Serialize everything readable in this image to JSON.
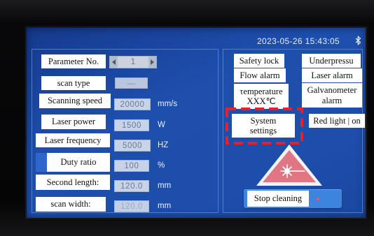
{
  "status_bar": {
    "datetime": "2023-05-26 15:43:05",
    "bluetooth_icon": "bluetooth-icon"
  },
  "parameters": {
    "parameter_no": {
      "label": "Parameter No.",
      "value": "1",
      "decrement_icon": "arrow-left-icon",
      "increment_icon": "arrow-right-icon"
    },
    "scan_type": {
      "label": "scan type",
      "value": "—"
    },
    "scanning_speed": {
      "label": "Scanning speed",
      "value": "20000",
      "unit": "mm/s"
    },
    "laser_power": {
      "label": "Laser power",
      "value": "1500",
      "unit": "W"
    },
    "laser_frequency": {
      "label": "Laser frequency",
      "value": "5000",
      "unit": "HZ"
    },
    "duty_ratio": {
      "label": "Duty ratio",
      "value": "100",
      "unit": "%"
    },
    "second_length": {
      "label": "Second length:",
      "value": "120.0",
      "unit": "mm"
    },
    "scan_width": {
      "label": "scan width:",
      "value": "120.0",
      "unit": "mm"
    }
  },
  "alarms": {
    "safety_lock": "Safety lock",
    "underpressure": "Underpressu",
    "flow_alarm": "Flow alarm",
    "laser_alarm": "Laser alarm",
    "temperature": {
      "label": "τemperature",
      "value": "XXX℃"
    },
    "galvanometer_alarm": [
      "Galvanometer",
      "alarm"
    ]
  },
  "controls": {
    "system_settings": [
      "System",
      "settings"
    ],
    "red_light": "Red light | on",
    "laser_warning_icon": "laser-warning-icon",
    "stop_cleaning": "Stop cleaning",
    "stop_indicator_icon": "red-dot-icon"
  },
  "colors": {
    "screen_blue": "#1e4fad",
    "panel_border": "#4f7bcb",
    "label_background": "#ffffff",
    "highlight_red": "#e5222b",
    "warning_fill": "#e07584",
    "button_blue": "#3d84de"
  }
}
